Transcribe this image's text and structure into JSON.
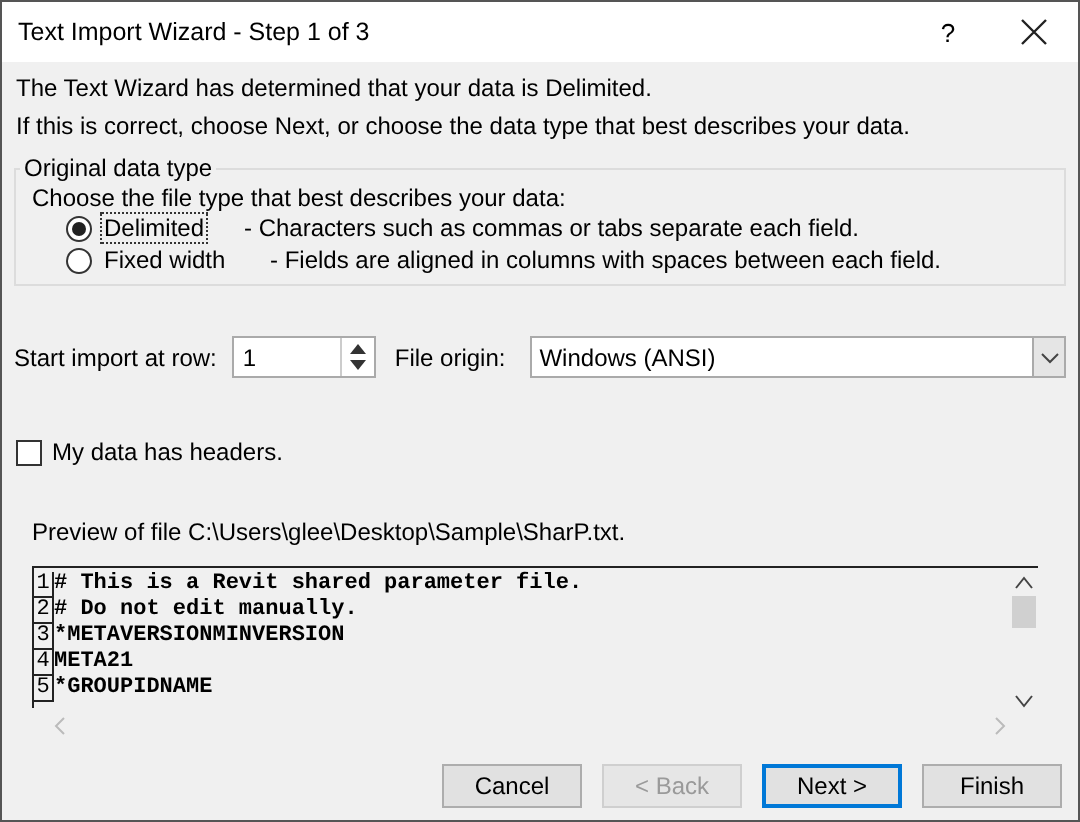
{
  "window": {
    "title": "Text Import Wizard - Step 1 of 3",
    "help": "?"
  },
  "intro": [
    "The Text Wizard has determined that your data is Delimited.",
    "If this is correct, choose Next, or choose the data type that best describes your data."
  ],
  "data_type_group": {
    "legend": "Original data type",
    "prompt": "Choose the file type that best describes your data:",
    "options": [
      {
        "label": "Delimited",
        "description": "- Characters such as commas or tabs separate each field.",
        "selected": true
      },
      {
        "label": "Fixed width",
        "description": "- Fields are aligned in columns with spaces between each field.",
        "selected": false
      }
    ]
  },
  "start_row": {
    "label": "Start import at row:",
    "value": "1"
  },
  "file_origin": {
    "label": "File origin:",
    "value": "Windows (ANSI)"
  },
  "headers_checkbox": {
    "label": "My data has headers.",
    "checked": false
  },
  "preview": {
    "label": "Preview of file C:\\Users\\glee\\Desktop\\Sample\\SharP.txt.",
    "lines": [
      {
        "number": "1",
        "text": "# This is a Revit shared parameter file."
      },
      {
        "number": "2",
        "text": "# Do not edit manually."
      },
      {
        "number": "3",
        "text": "*METAVERSIONMINVERSION"
      },
      {
        "number": "4",
        "text": "META21"
      },
      {
        "number": "5",
        "text": "*GROUPIDNAME"
      }
    ]
  },
  "buttons": [
    {
      "label": "Cancel",
      "disabled": false,
      "default": false
    },
    {
      "label": "< Back",
      "disabled": true,
      "default": false
    },
    {
      "label": "Next >",
      "disabled": false,
      "default": true
    },
    {
      "label": "Finish",
      "disabled": false,
      "default": false
    }
  ]
}
